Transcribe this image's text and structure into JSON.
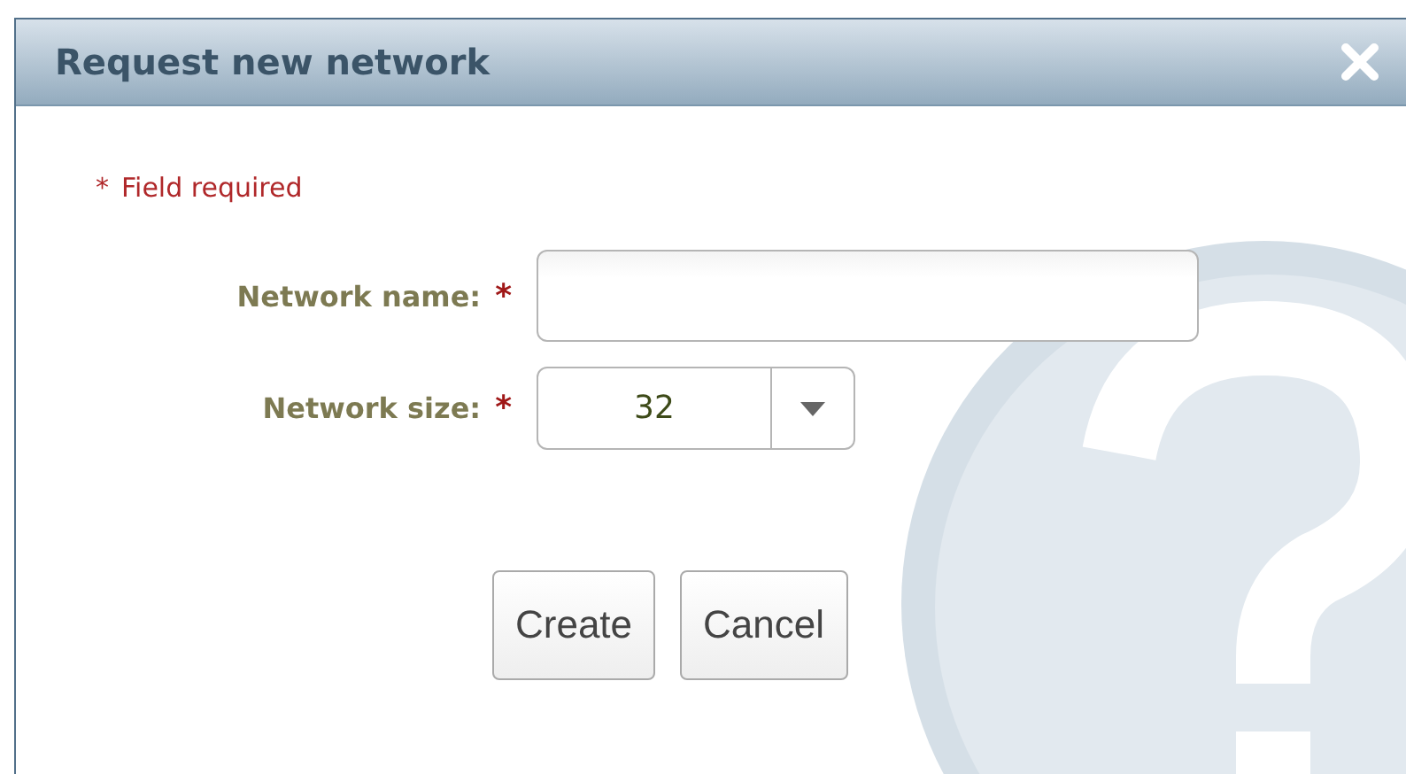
{
  "dialog": {
    "title": "Request new network"
  },
  "required_note": {
    "mark": "*",
    "text": "Field required"
  },
  "fields": [
    {
      "kind": "text",
      "label": "Network name:",
      "required_mark": "*"
    },
    {
      "kind": "select",
      "label": "Network size:",
      "required_mark": "*",
      "value": "32"
    }
  ],
  "buttons": [
    "Create",
    "Cancel"
  ]
}
